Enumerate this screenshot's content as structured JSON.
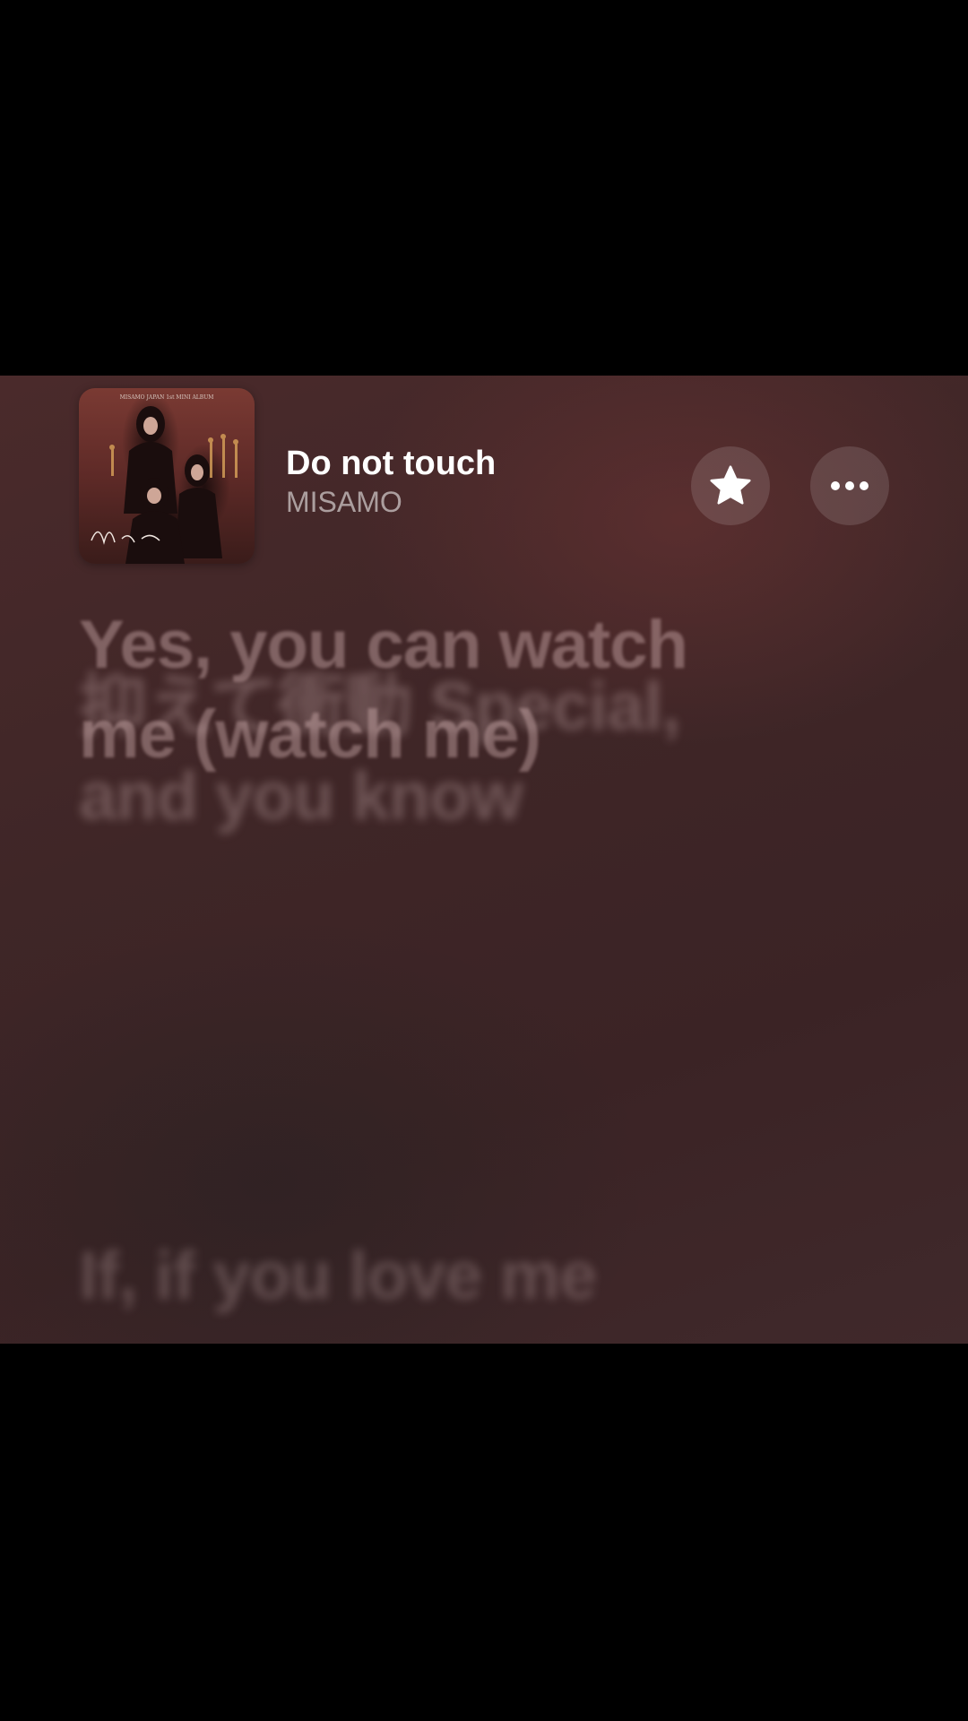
{
  "now_playing": {
    "title": "Do not touch",
    "artist": "MISAMO"
  },
  "buttons": {
    "favorite_icon": "star-icon",
    "more_icon": "ellipsis-icon"
  },
  "lyrics": [
    "抑えて衝動 Special,\nand you know",
    "Yes, you can watch\nme (watch me)",
    "If, if you love me"
  ],
  "colors": {
    "background": "#3f2627",
    "title": "#ffffff",
    "artist": "#a89a9a"
  }
}
